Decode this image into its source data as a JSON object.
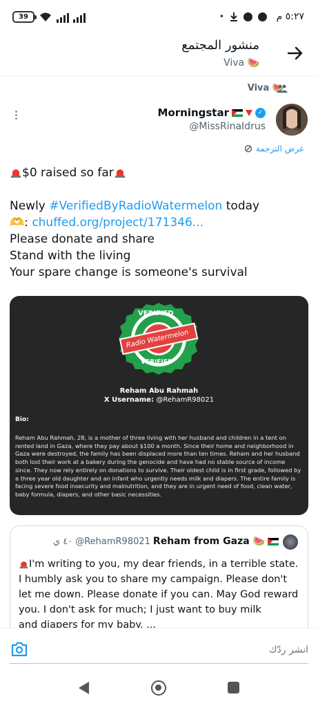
{
  "status_bar": {
    "battery": "39",
    "time": "٥:٢٧ م",
    "dot": "•"
  },
  "header": {
    "title": "منشور المجتمع",
    "subtitle": "Viva 🍉"
  },
  "community": {
    "label": "Viva 🍉"
  },
  "author": {
    "display_name": "Morningstar",
    "handle": "@MissRinaIdrus"
  },
  "translate_label": "عرض الترجمة",
  "tweet": {
    "line1_text": "$0 raised so far",
    "line2_prefix": "Newly ",
    "line2_hashtag": "#VerifiedByRadioWatermelon",
    "line2_suffix": " today",
    "line3_emoji": "🫶",
    "line3_link": "chuffed.org/project/171346...",
    "line4": "Please donate and share",
    "line5": "Stand with the living",
    "line6": "Your spare change is someone's survival"
  },
  "card": {
    "seal_top": "VERIFIED",
    "seal_middle": "Radio Watermelon",
    "seal_bottom": "VERIFIED",
    "name": "Reham Abu Rahmah",
    "username_label": "X Username: ",
    "username": "@RehamR98021",
    "bio_label": "Bio:",
    "bio": "Reham Abu Rahmah, 28, is a mother of three living with her husband and children in a tent on rented land in Gaza, where they pay about $100 a month. Since their home and neighborhood in Gaza were destroyed, the family has been displaced more than ten times. Reham and her husband both lost their work at a bakery during the genocide and have had no stable source of income since. They now rely entirely on donations to survive. Their oldest child is in first grade, followed by a three year old daughter and an infant who urgently needs milk and diapers. The entire family is facing severe food insecurity and malnutrition, and they are in urgent need of food, clean water, baby formula, diapers, and other basic necessities."
  },
  "quote": {
    "name": "Reham from Gaza 🍉",
    "handle": "@RehamR98021",
    "time": "٤٠ ي",
    "text1": "I'm writing to you, my dear friends, in a terrible state. I humbly ask you to share my campaign. Please don't let me down. Please donate if you can. May God reward you. I don't ask for much; I just want to buy milk",
    "text2": "and diapers for my baby. ..."
  },
  "reply": {
    "placeholder": "انشر ردّك"
  },
  "colors": {
    "accent": "#1d9bf0",
    "card_bg": "#262626",
    "text": "#0f1419",
    "muted": "#536471"
  },
  "icons": [
    "battery-icon",
    "wifi-icon",
    "signal-icon",
    "download-icon",
    "messenger-icon",
    "back-arrow-icon",
    "people-icon",
    "verified-icon",
    "more-icon",
    "translate-icon",
    "siren-icon",
    "camera-icon",
    "nav-back-icon",
    "nav-home-icon",
    "nav-recents-icon"
  ]
}
